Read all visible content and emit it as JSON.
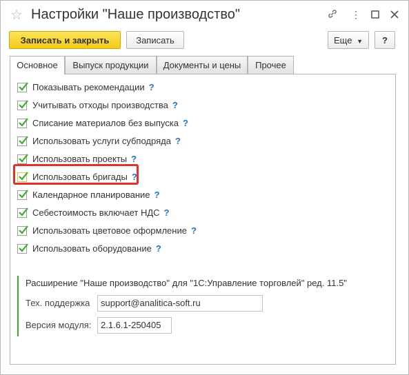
{
  "window": {
    "title": "Настройки \"Наше производство\""
  },
  "titlebar_icons": {
    "favorite": "star-icon",
    "link": "link-icon",
    "more": "more-vertical-icon",
    "maximize": "maximize-icon",
    "close": "close-icon"
  },
  "toolbar": {
    "save_close_label": "Записать и закрыть",
    "save_label": "Записать",
    "more_label": "Еще",
    "help_label": "?"
  },
  "tabs": [
    {
      "label": "Основное",
      "active": true
    },
    {
      "label": "Выпуск продукции",
      "active": false
    },
    {
      "label": "Документы и цены",
      "active": false
    },
    {
      "label": "Прочее",
      "active": false
    }
  ],
  "settings": [
    {
      "label": "Показывать рекомендации",
      "checked": true,
      "help": "?"
    },
    {
      "label": "Учитывать отходы производства",
      "checked": true,
      "help": "?"
    },
    {
      "label": "Списание материалов без выпуска",
      "checked": true,
      "help": "?"
    },
    {
      "label": "Использовать услуги субподряда",
      "checked": true,
      "help": "?"
    },
    {
      "label": "Использовать проекты",
      "checked": true,
      "help": "?"
    },
    {
      "label": "Использовать бригады",
      "checked": true,
      "help": "?",
      "highlighted": true
    },
    {
      "label": "Календарное планирование",
      "checked": true,
      "help": "?"
    },
    {
      "label": "Себестоимость включает НДС",
      "checked": true,
      "help": "?"
    },
    {
      "label": "Использовать цветовое оформление",
      "checked": true,
      "help": "?"
    },
    {
      "label": "Использовать оборудование",
      "checked": true,
      "help": "?"
    }
  ],
  "extension": {
    "title": "Расширение \"Наше производство\" для \"1С:Управление торговлей\" ред. 11.5\"",
    "support_label": "Тех. поддержка",
    "support_value": "support@analitica-soft.ru",
    "version_label": "Версия модуля:",
    "version_value": "2.1.6.1-250405"
  },
  "colors": {
    "primary_button": "#f4cc16",
    "checkmark": "#3bab2b",
    "help": "#1f75c8",
    "highlight": "#e0312b"
  }
}
